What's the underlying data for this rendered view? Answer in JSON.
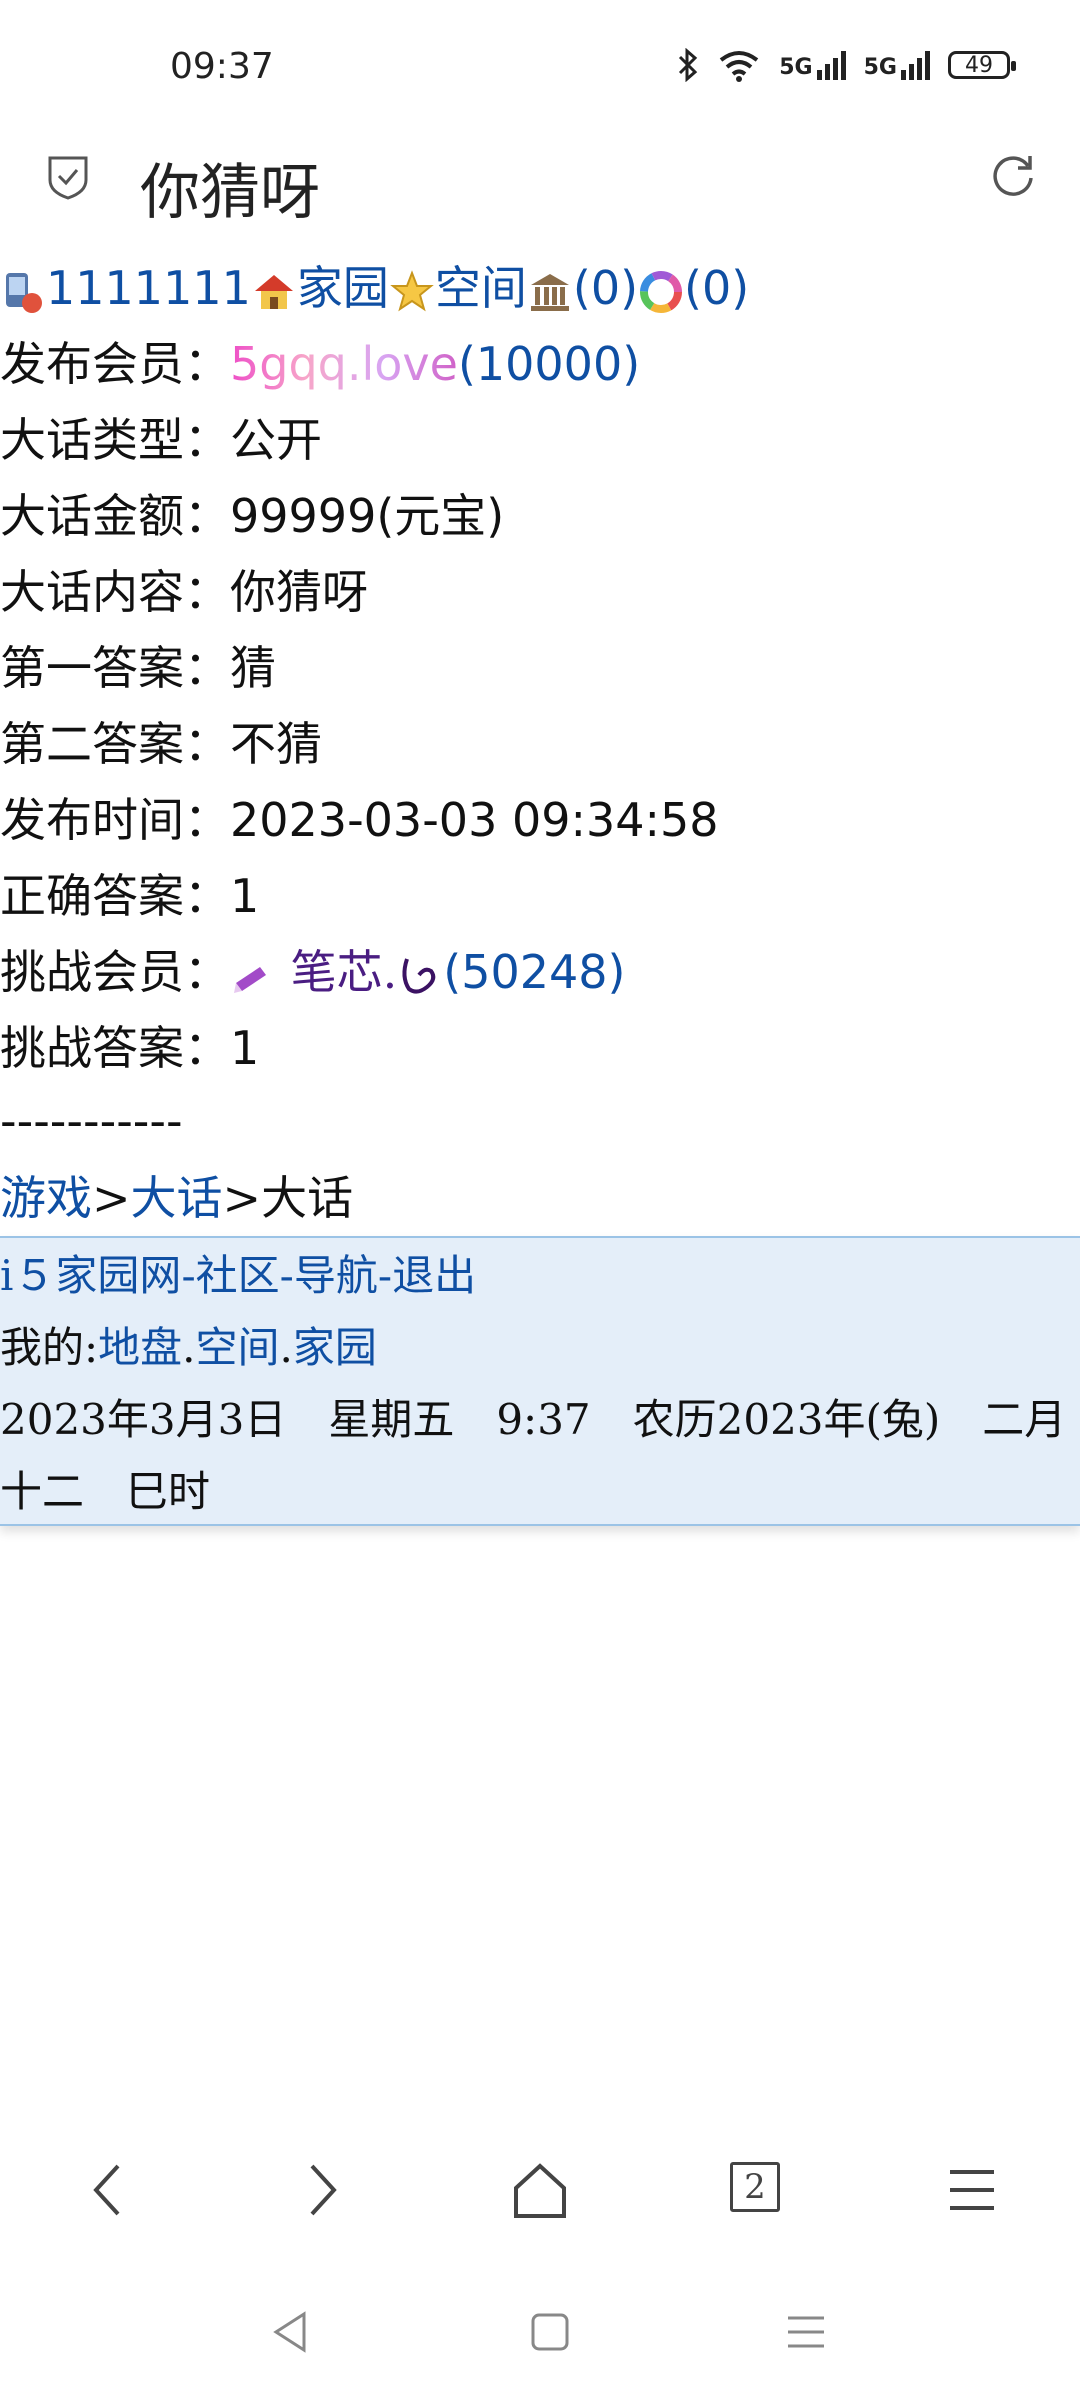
{
  "status": {
    "time": "09:37",
    "battery": "49",
    "signal1": "5G",
    "signal2": "5G"
  },
  "header": {
    "title": "你猜呀"
  },
  "user_bar": {
    "id": "1111111",
    "home_label": "家园",
    "space_label": "空间",
    "bank_count": "(0)",
    "color_count": "(0)"
  },
  "details": {
    "publisher_label": "发布会员：",
    "publisher_name": "5gqq.love",
    "publisher_id": "(10000)",
    "type_label": "大话类型：",
    "type_value": "公开",
    "amount_label": "大话金额：",
    "amount_value": "99999(元宝)",
    "content_label": "大话内容：",
    "content_value": "你猜呀",
    "answer1_label": "第一答案：",
    "answer1_value": "猜",
    "answer2_label": "第二答案：",
    "answer2_value": "不猜",
    "time_label": "发布时间：",
    "time_value": "2023-03-03 09:34:58",
    "correct_label": "正确答案：",
    "correct_value": "1",
    "challenger_label": "挑战会员：",
    "challenger_name": "笔芯.",
    "challenger_id": "(50248)",
    "challenge_answer_label": "挑战答案：",
    "challenge_answer_value": "1"
  },
  "divider": "-----------",
  "breadcrumb": {
    "games": "游戏",
    "sep1": ">",
    "dahua_link": "大话",
    "sep2": ">",
    "current": "大话"
  },
  "footer": {
    "site": "i５家园网",
    "dash1": "-",
    "community": "社区",
    "dash2": "-",
    "nav": "导航",
    "dash3": "-",
    "logout": "退出",
    "mine_label": "我的:",
    "territory": "地盘",
    "dot1": ".",
    "space": "空间",
    "dot2": ".",
    "home": "家园",
    "date_line1": "2023年3月3日　星期五　9:37　农历2023年(兔)　二月",
    "date_line2": "十二　巳时"
  },
  "navbar": {
    "tabs_count": "2"
  }
}
